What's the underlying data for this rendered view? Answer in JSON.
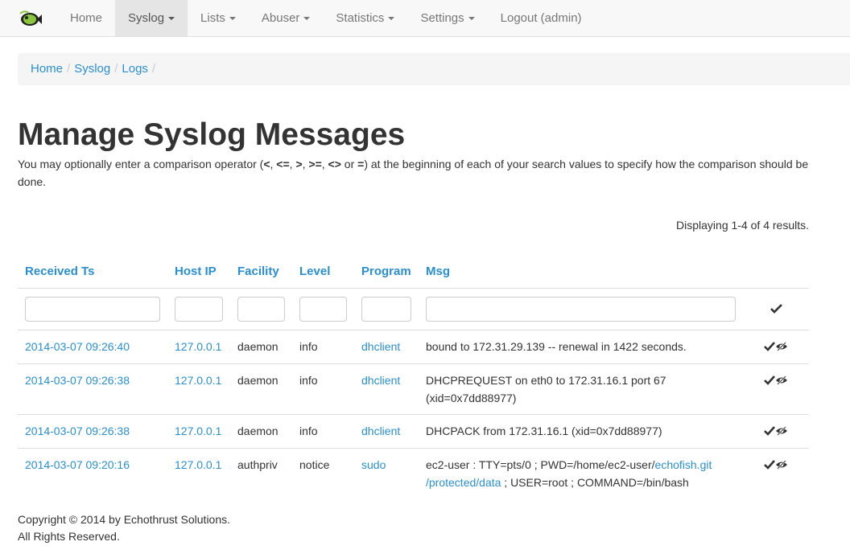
{
  "navbar": {
    "items": [
      {
        "label": "Home"
      },
      {
        "label": "Syslog"
      },
      {
        "label": "Lists"
      },
      {
        "label": "Abuser"
      },
      {
        "label": "Statistics"
      },
      {
        "label": "Settings"
      },
      {
        "label": "Logout (admin)"
      }
    ],
    "active": "Syslog"
  },
  "breadcrumb": [
    "Home",
    "Syslog",
    "Logs"
  ],
  "page": {
    "title": "Manage Syslog Messages",
    "lead_prefix": "You may optionally enter a comparison operator (",
    "operators": [
      "<",
      "<=",
      ">",
      ">=",
      "<>",
      "="
    ],
    "lead_suffix": ") at the beginning of each of your search values to specify how the comparison should be done."
  },
  "summary": "Displaying 1-4 of 4 results.",
  "grid": {
    "columns": [
      "Received Ts",
      "Host IP",
      "Facility",
      "Level",
      "Program",
      "Msg"
    ],
    "filters": [
      "",
      "",
      "",
      "",
      "",
      ""
    ],
    "rows": [
      {
        "ts": "2014-03-07 09:26:40",
        "host": "127.0.0.1",
        "facility": "daemon",
        "level": "info",
        "program": "dhclient",
        "msg": "bound to 172.31.29.139 -- renewal in 1422 seconds."
      },
      {
        "ts": "2014-03-07 09:26:38",
        "host": "127.0.0.1",
        "facility": "daemon",
        "level": "info",
        "program": "dhclient",
        "msg": "DHCPREQUEST on eth0 to 172.31.16.1 port 67 (xid=0x7dd88977)"
      },
      {
        "ts": "2014-03-07 09:26:38",
        "host": "127.0.0.1",
        "facility": "daemon",
        "level": "info",
        "program": "dhclient",
        "msg": "DHCPACK from 172.31.16.1 (xid=0x7dd88977)"
      },
      {
        "ts": "2014-03-07 09:20:16",
        "host": "127.0.0.1",
        "facility": "authpriv",
        "level": "notice",
        "program": "sudo",
        "msg_parts": [
          "ec2-user : TTY=pts/0 ; PWD=/home/ec2-user/",
          "echofish.git /protected/data",
          " ; USER=root ; COMMAND=/bin/bash"
        ]
      }
    ]
  },
  "footer": {
    "line1": "Copyright © 2014 by Echothrust Solutions.",
    "line2": "All Rights Reserved."
  },
  "icons": {
    "brand": "echofish-logo-icon",
    "approve": "checkmark-icon",
    "hide": "eye-slash-icon"
  },
  "colors": {
    "link": "#2a8fcf",
    "navbar_bg": "#f8f8f8",
    "nav_active_bg": "#e5e5e5",
    "breadcrumb_bg": "#f5f5f5"
  }
}
